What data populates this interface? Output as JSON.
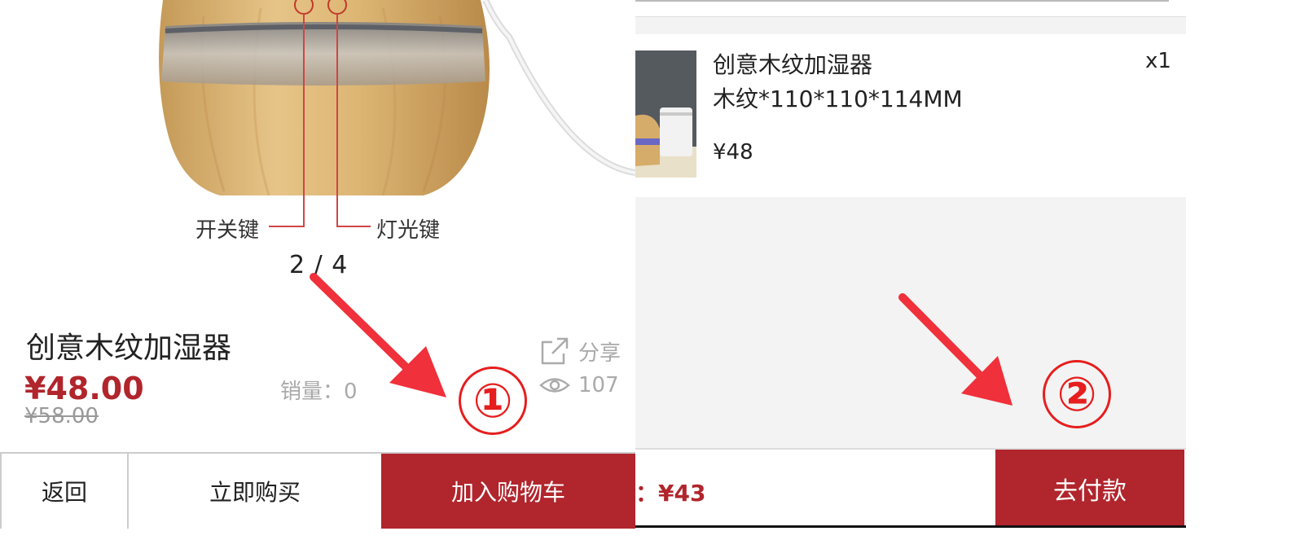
{
  "left": {
    "callouts": {
      "power_key": "开关键",
      "light_key": "灯光键"
    },
    "pager": "2 / 4",
    "product": {
      "title": "创意木纹加湿器",
      "price": "¥48.00",
      "original_price": "¥58.00",
      "sales": "销量：0",
      "share_label": "分享",
      "views": "107"
    },
    "bottom_bar": {
      "back": "返回",
      "buy_now": "立即购买",
      "add_to_cart": "加入购物车"
    }
  },
  "right": {
    "item": {
      "name": "创意木纹加湿器",
      "spec": "木纹*110*110*114MM",
      "price": "¥48",
      "qty": "x1"
    },
    "checkout": {
      "total": "：¥43",
      "pay_button": "去付款"
    }
  },
  "annotations": {
    "step1": "①",
    "step2": "②",
    "arrow_color": "#f0303a"
  },
  "colors": {
    "brand_red": "#b1252c",
    "annotation_red": "#e61e1e"
  },
  "icons": [
    "share-icon",
    "eye-icon",
    "product-photo",
    "item-thumbnail"
  ]
}
